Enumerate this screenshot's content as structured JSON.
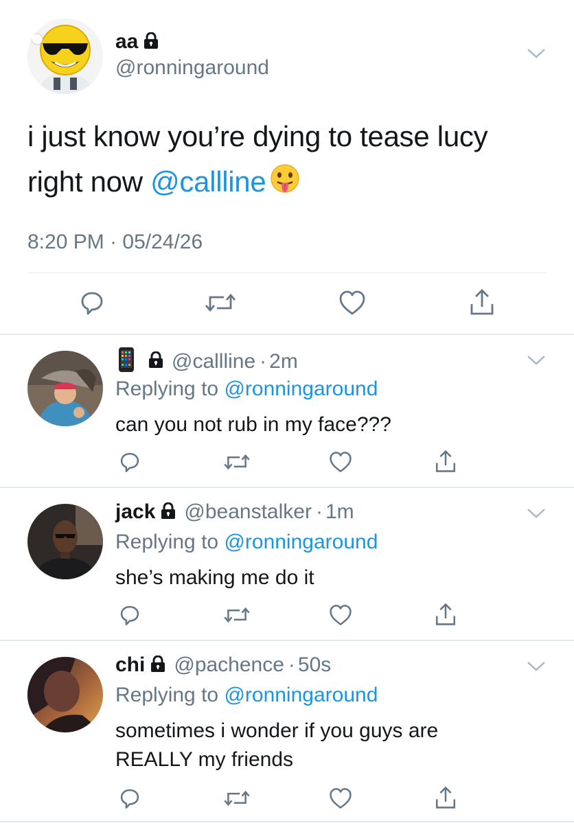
{
  "main_tweet": {
    "name": "aa",
    "handle": "@ronningaround",
    "text_part1": "i just know you’re dying to tease lucy right now ",
    "mention": "@callline",
    "timestamp": "8:20 PM · 05/24/26"
  },
  "replies": [
    {
      "name": "",
      "handle": "@callline",
      "time": "2m",
      "replying_label": "Replying to ",
      "replying_to": "@ronningaround",
      "text": "can you not rub in my face???"
    },
    {
      "name": "jack",
      "handle": "@beanstalker",
      "time": "1m",
      "replying_label": "Replying to ",
      "replying_to": "@ronningaround",
      "text": "she’s making me do it"
    },
    {
      "name": "chi",
      "handle": "@pachence",
      "time": "50s",
      "replying_label": "Replying to ",
      "replying_to": "@ronningaround",
      "text": "sometimes i wonder if you guys are REALLY my friends"
    }
  ],
  "icons": {
    "reply": "reply-icon",
    "retweet": "retweet-icon",
    "like": "like-icon",
    "share": "share-icon",
    "lock": "lock-icon",
    "chevron": "chevron-down-icon",
    "phone_emoji": "phone-emoji-icon",
    "tongue_emoji": "tongue-out-emoji-icon"
  },
  "colors": {
    "mention_blue": "#1b95e0",
    "secondary_gray": "#657786",
    "text_dark": "#14171a",
    "divider": "#e1e8ed"
  }
}
